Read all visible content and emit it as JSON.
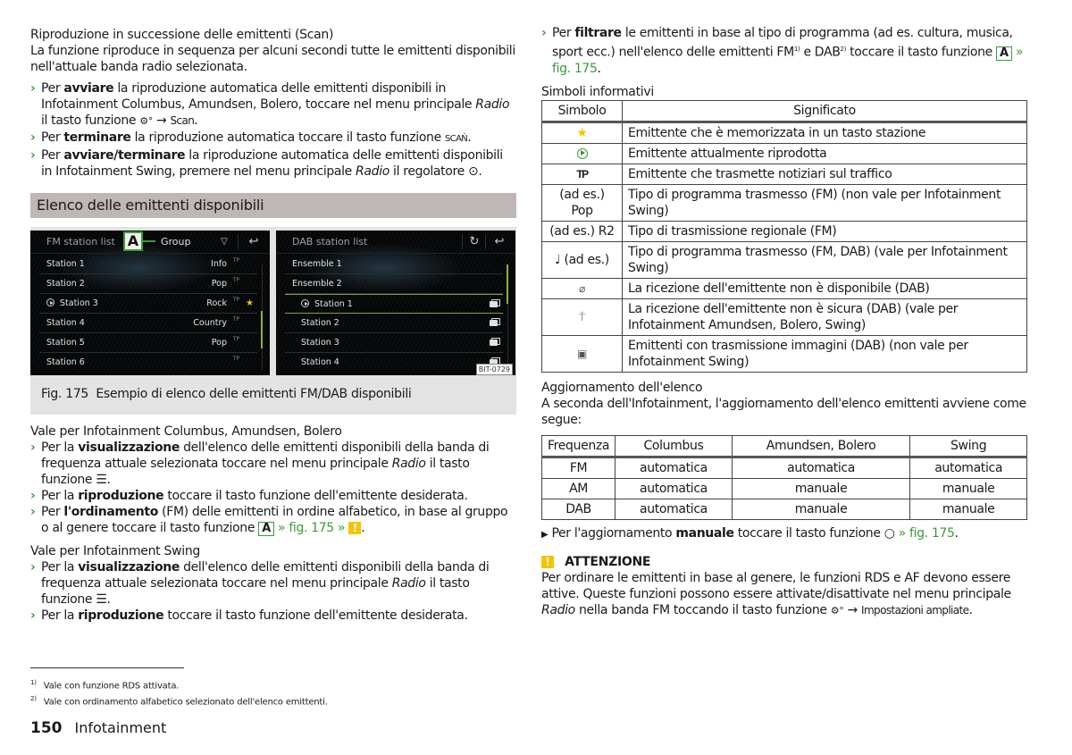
{
  "left": {
    "scan": {
      "heading": "Riproduzione in successione delle emittenti (Scan)",
      "intro": "La funzione riproduce in sequenza per alcuni secondi tutte le emittenti disponibili nell'attuale banda radio selezionata.",
      "bullets": [
        {
          "pre": "Per ",
          "bold": "avviare",
          "post": " la riproduzione automatica delle emittenti disponibili in Infotainment Columbus, Amundsen, Bolero, toccare nel menu principale ",
          "ital": "Radio",
          "post2": " il tasto funzione ",
          "icon": "⚙°",
          "arrow": " → ",
          "key": "Scan",
          "end": "."
        },
        {
          "pre": "Per ",
          "bold": "terminare",
          "post": " la riproduzione automatica toccare il tasto funzione ",
          "key": "SCAŃ",
          "end": "."
        },
        {
          "pre": "Per ",
          "bold": "avviare/terminare",
          "post": " la riproduzione automatica delle emittenti disponibili in Infotainment Swing, premere nel menu principale ",
          "ital": "Radio",
          "post2": " il regolatore ",
          "icon": "⊙",
          "end": "."
        }
      ]
    },
    "section_title": "Elenco delle emittenti disponibili",
    "figure": {
      "fm": {
        "title": "FM station list",
        "marker": "A",
        "group_label": "Group",
        "dropdown_icon": "▽",
        "back_icon": "↩",
        "rows": [
          {
            "name": "Station 1",
            "genre": "Info",
            "tp": "TP"
          },
          {
            "name": "Station 2",
            "genre": "Pop",
            "tp": "TP"
          },
          {
            "name": "Station 3",
            "genre": "Rock",
            "tp": "TP",
            "playing": true,
            "star": "★"
          },
          {
            "name": "Station 4",
            "genre": "Country",
            "tp": "TP"
          },
          {
            "name": "Station 5",
            "genre": "Pop",
            "tp": "TP"
          },
          {
            "name": "Station 6",
            "genre": "",
            "tp": "TP"
          }
        ]
      },
      "dab": {
        "title": "DAB station list",
        "refresh_icon": "↻",
        "back_icon": "↩",
        "rows": [
          {
            "name": "Ensemble 1"
          },
          {
            "name": "Ensemble 2"
          },
          {
            "name": "Station 1",
            "playing": true
          },
          {
            "name": "Station 2"
          },
          {
            "name": "Station 3"
          },
          {
            "name": "Station 4"
          }
        ]
      },
      "code": "BIT-0729",
      "caption_num": "Fig. 175",
      "caption_text": "Esempio di elenco delle emittenti FM/DAB disponibili"
    },
    "columbus": {
      "heading": "Vale per Infotainment Columbus, Amundsen, Bolero",
      "b1_pre": "Per la ",
      "b1_bold": "visualizzazione",
      "b1_post": " dell'elenco delle emittenti disponibili della banda di frequenza attuale selezionata toccare nel menu principale ",
      "b1_ital": "Radio",
      "b1_end": " il tasto funzione ☰.",
      "b2_pre": "Per la ",
      "b2_bold": "riproduzione",
      "b2_post": " toccare il tasto funzione dell'emittente desiderata.",
      "b3_pre": "Per ",
      "b3_bold": "l'ordinamento",
      "b3_post": " (FM) delle emittenti in ordine alfabetico, in base al gruppo o al genere toccare il tasto funzione ",
      "b3_key": "A",
      "b3_link": "» fig. 175 »",
      "b3_warn": "!",
      "b3_end": "."
    },
    "swing": {
      "heading": "Vale per Infotainment Swing",
      "b1_pre": "Per la ",
      "b1_bold": "visualizzazione",
      "b1_post": " dell'elenco delle emittenti disponibili della banda di frequenza attuale selezionata toccare nel menu principale ",
      "b1_ital": "Radio",
      "b1_end": " il tasto funzione ☰.",
      "b2_pre": "Per la ",
      "b2_bold": "riproduzione",
      "b2_post": " toccare il tasto funzione dell'emittente desiderata."
    },
    "footnotes": [
      {
        "mark": "1)",
        "text": "Vale con funzione RDS attivata."
      },
      {
        "mark": "2)",
        "text": "Vale con ordinamento alfabetico selezionato dell'elenco emittenti."
      }
    ],
    "page_number": "150",
    "chapter": "Infotainment"
  },
  "right": {
    "filter": {
      "pre": "Per ",
      "bold": "filtrare",
      "post": " le emittenti in base al tipo di programma (ad es. cultura, musica, sport ecc.) nell'elenco delle emittenti FM",
      "sup1": "1)",
      "mid": " e DAB",
      "sup2": "2)",
      "post2": " toccare il tasto funzione ",
      "key": "A",
      "link": "» fig. 175",
      "end": "."
    },
    "symbols": {
      "heading": "Simboli informativi",
      "col_symbol": "Simbolo",
      "col_meaning": "Significato",
      "rows": [
        {
          "symbol": "★",
          "icon": "star-icon",
          "meaning": "Emittente che è memorizzata in un tasto stazione"
        },
        {
          "symbol": "▶",
          "icon": "play-circle-icon",
          "meaning": "Emittente attualmente riprodotta"
        },
        {
          "symbol": "TP",
          "icon": "tp-icon",
          "meaning": "Emittente che trasmette notiziari sul traffico"
        },
        {
          "symbol": "(ad es.) Pop",
          "icon": "program-type-icon",
          "meaning": "Tipo di programma trasmesso (FM) (non vale per Infotainment Swing)"
        },
        {
          "symbol": "(ad es.) R2",
          "icon": "regional-icon",
          "meaning": "Tipo di trasmissione regionale (FM)"
        },
        {
          "symbol": "♩ (ad es.)",
          "icon": "music-note-icon",
          "meaning": "Tipo di programma trasmesso (FM, DAB) (vale per Infotainment Swing)"
        },
        {
          "symbol": "⌀",
          "icon": "no-reception-icon",
          "meaning": "La ricezione dell'emittente non è disponibile (DAB)"
        },
        {
          "symbol": "⍑",
          "icon": "weak-reception-icon",
          "meaning": "La ricezione dell'emittente non è sicura (DAB) (vale per Infotainment Amundsen, Bolero, Swing)"
        },
        {
          "symbol": "▣",
          "icon": "slideshow-icon",
          "meaning": "Emittenti con trasmissione immagini (DAB) (non vale per Infotainment Swing)"
        }
      ]
    },
    "update": {
      "heading": "Aggiornamento dell'elenco",
      "intro": "A seconda dell'Infotainment, l'aggiornamento dell'elenco emittenti avviene come segue:",
      "headers": [
        "Frequenza",
        "Columbus",
        "Amundsen, Bolero",
        "Swing"
      ],
      "rows": [
        [
          "FM",
          "automatica",
          "automatica",
          "automatica"
        ],
        [
          "AM",
          "automatica",
          "manuale",
          "manuale"
        ],
        [
          "DAB",
          "automatica",
          "manuale",
          "manuale"
        ]
      ],
      "manual_pre": "Per l'aggiornamento ",
      "manual_bold": "manuale",
      "manual_post": " toccare il tasto funzione ",
      "manual_icon": "○",
      "manual_link": "» fig. 175",
      "manual_end": "."
    },
    "warning": {
      "icon": "!",
      "title": "ATTENZIONE",
      "text_pre": "Per ordinare le emittenti in base al genere, le funzioni RDS e AF devono essere attive. Queste funzioni possono essere attivate/disattivate nel menu principale ",
      "text_ital": "Radio",
      "text_post": " nella banda FM toccando il tasto funzione ",
      "text_icon": "⚙°",
      "text_arrow": " → ",
      "text_key": "Impostazioni ampliate",
      "text_end": "."
    }
  },
  "colors": {
    "accent_green": "#3a9a3a",
    "warning_yellow": "#f5c400",
    "section_bg": "#bfb6b6",
    "caption_bg": "#e4e3e3"
  }
}
